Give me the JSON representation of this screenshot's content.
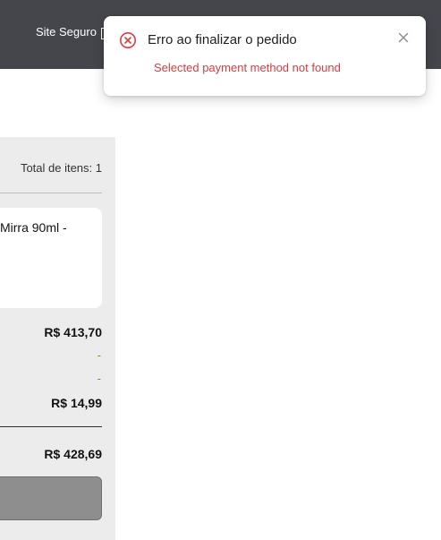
{
  "header": {
    "secure_label": "Site Seguro"
  },
  "summary": {
    "total_items": "Total de itens: 1",
    "product_name": "Mirra 90ml -",
    "subtotal": "R$ 413,70",
    "line_two": "-",
    "line_three": "-",
    "shipping": "R$ 14,99",
    "total": "R$ 428,69",
    "button_label": ""
  },
  "toast": {
    "title": "Erro ao finalizar o pedido",
    "message": "Selected payment method not found",
    "icon": "error-circle-x-icon",
    "close_icon": "close-icon"
  },
  "colors": {
    "header_bg": "#45464b",
    "panel_bg": "#ececec",
    "error_red": "#e0393e",
    "accent_dash": "#7a8c2a",
    "button_bg": "#8e8e8e"
  }
}
